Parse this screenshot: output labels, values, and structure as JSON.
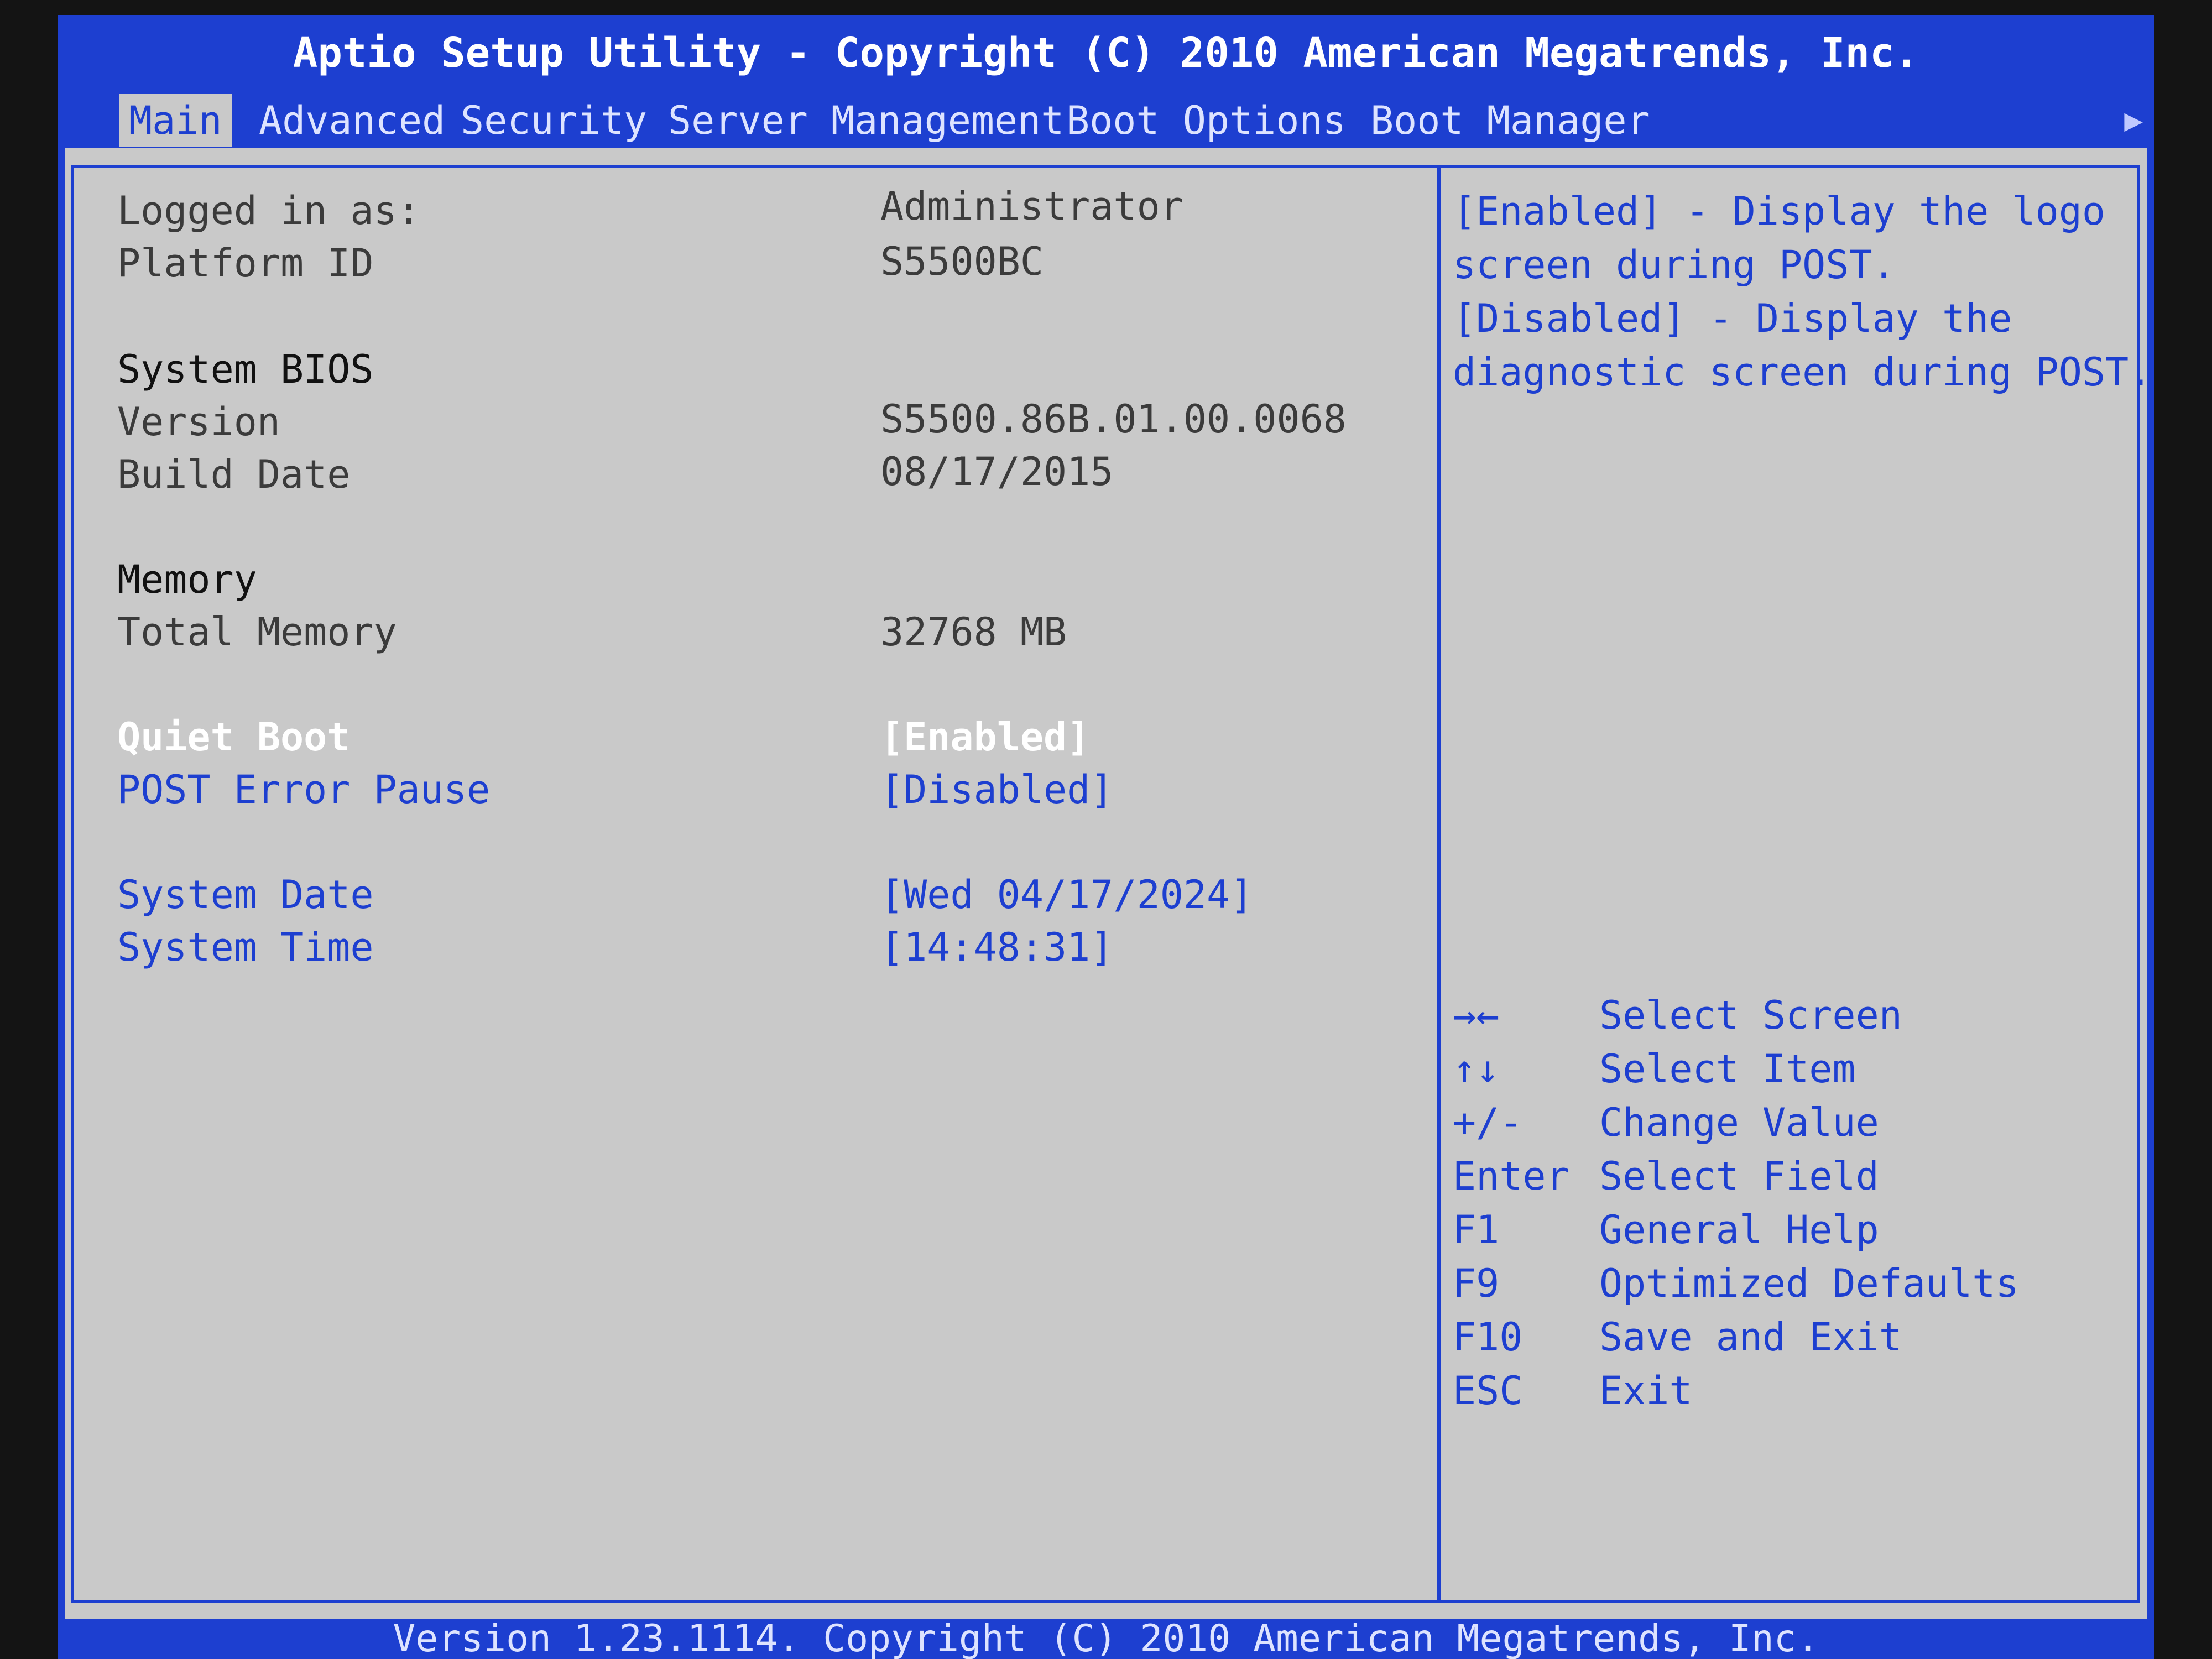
{
  "header": {
    "title": "Aptio Setup Utility - Copyright (C) 2010 American Megatrends, Inc."
  },
  "tabs": [
    {
      "label": "Main",
      "active": true
    },
    {
      "label": "Advanced"
    },
    {
      "label": "Security"
    },
    {
      "label": "Server Management"
    },
    {
      "label": "Boot Options"
    },
    {
      "label": "Boot Manager"
    }
  ],
  "tab_scroll_icon": "right-arrow-icon",
  "main": {
    "logged_in": {
      "label": "Logged in as:",
      "value": "Administrator"
    },
    "platform": {
      "label": "Platform ID",
      "value": "S5500BC"
    },
    "bios_heading": "System BIOS",
    "bios_version": {
      "label": "Version",
      "value": "S5500.86B.01.00.0068"
    },
    "bios_build": {
      "label": "Build Date",
      "value": "08/17/2015"
    },
    "memory_heading": "Memory",
    "total_memory": {
      "label": "Total Memory",
      "value": "32768 MB"
    },
    "quiet_boot": {
      "label": "Quiet Boot",
      "value": "[Enabled]"
    },
    "post_error_pause": {
      "label": "POST Error Pause",
      "value": "[Disabled]"
    },
    "system_date": {
      "label": "System Date",
      "value": "[Wed 04/17/2024]"
    },
    "system_time": {
      "label": "System Time",
      "value": "[14:48:31]"
    }
  },
  "help": {
    "lines": [
      "[Enabled] - Display the logo",
      "screen during POST.",
      "[Disabled] - Display the",
      "diagnostic screen during POST."
    ]
  },
  "keys": [
    {
      "key": "→←",
      "desc": "Select Screen"
    },
    {
      "key": "↑↓",
      "desc": "Select Item"
    },
    {
      "key": "+/-",
      "desc": "Change Value"
    },
    {
      "key": "Enter",
      "desc": "Select Field"
    },
    {
      "key": "F1",
      "desc": "General Help"
    },
    {
      "key": "F9",
      "desc": "Optimized Defaults"
    },
    {
      "key": "F10",
      "desc": "Save and Exit"
    },
    {
      "key": "ESC",
      "desc": "Exit"
    }
  ],
  "footer": {
    "text": "Version 1.23.1114. Copyright (C) 2010 American Megatrends, Inc."
  },
  "colors": {
    "bios_blue": "#1d3fd0",
    "panel_gray": "#c9c9c9",
    "highlight": "#ffffff"
  }
}
